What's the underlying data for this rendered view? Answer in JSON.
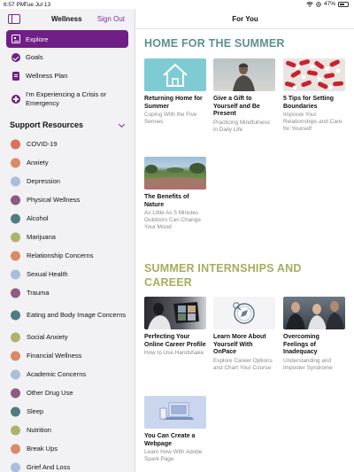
{
  "status_bar": {
    "time": "6:57 PM",
    "date": "Tue Jul 13",
    "battery_text": "47%",
    "battery_level": 0.47
  },
  "sidebar": {
    "title": "Wellness",
    "signout_label": "Sign Out",
    "nav": [
      {
        "label": "Explore",
        "icon": "explore-icon"
      },
      {
        "label": "Goals",
        "icon": "check-circle-icon"
      },
      {
        "label": "Wellness Plan",
        "icon": "plan-icon"
      },
      {
        "label": "I'm Experiencing a Crisis or Emergency",
        "icon": "plus-circle-icon"
      }
    ],
    "support_title": "Support Resources",
    "resources": [
      {
        "label": "COVID-19",
        "color": "#d9715d"
      },
      {
        "label": "Anxiety",
        "color": "#d98a66"
      },
      {
        "label": "Depression",
        "color": "#a9bfd9"
      },
      {
        "label": "Physical Wellness",
        "color": "#8e5a82"
      },
      {
        "label": "Alcohol",
        "color": "#4e7d80"
      },
      {
        "label": "Marijuana",
        "color": "#adb46a"
      },
      {
        "label": "Relationship Concerns",
        "color": "#d98a66"
      },
      {
        "label": "Sexual Health",
        "color": "#a9bfd9"
      },
      {
        "label": "Trauma",
        "color": "#8e5a82"
      },
      {
        "label": "Eating and Body Image Concerns",
        "color": "#4e7d80"
      },
      {
        "label": "Social Anxiety",
        "color": "#adb46a"
      },
      {
        "label": "Financial Wellness",
        "color": "#d98a66"
      },
      {
        "label": "Academic Concerns",
        "color": "#a9bfd9"
      },
      {
        "label": "Other Drug Use",
        "color": "#8e5a82"
      },
      {
        "label": "Sleep",
        "color": "#4e7d80"
      },
      {
        "label": "Nutrition",
        "color": "#adb46a"
      },
      {
        "label": "Break Ups",
        "color": "#d98a66"
      },
      {
        "label": "Grief And Loss",
        "color": "#a9bfd9"
      }
    ]
  },
  "main": {
    "title": "For You",
    "sections": [
      {
        "title": "HOME FOR THE SUMMER",
        "color": "#5e8f92",
        "cards": [
          {
            "title": "Returning Home for Summer",
            "subtitle": "Coping With the Five Senses",
            "image": "home-icon"
          },
          {
            "title": "Give a Gift to Yourself and Be Present",
            "subtitle": "Practicing Mindfulness in Daily Life",
            "image": "person-sky-photo"
          },
          {
            "title": "5 Tips for Setting Boundaries",
            "subtitle": "Improve Your Relationships and Care for Yourself",
            "image": "pills-photo"
          },
          {
            "title": "The Benefits of Nature",
            "subtitle": "As Little As 5 Minutes Outdoors Can Change Your Mood",
            "image": "garden-photo"
          }
        ]
      },
      {
        "title": "SUMMER INTERNSHIPS AND CAREER",
        "color": "#a8ad5e",
        "cards": [
          {
            "title": "Perfecting Your Online Career Profile",
            "subtitle": "How to Use Handshake",
            "image": "laptop-call-photo"
          },
          {
            "title": "Learn More About Yourself With OnPace",
            "subtitle": "Explore Career Options and Chart Your Course",
            "image": "compass-icon"
          },
          {
            "title": "Overcoming Feelings of Inadequacy",
            "subtitle": "Understanding and Imposter Syndrome",
            "image": "meeting-photo"
          },
          {
            "title": "You Can Create a Webpage",
            "subtitle": "Learn How With Adobe Spark Page",
            "image": "devices-illustration"
          }
        ]
      }
    ]
  }
}
